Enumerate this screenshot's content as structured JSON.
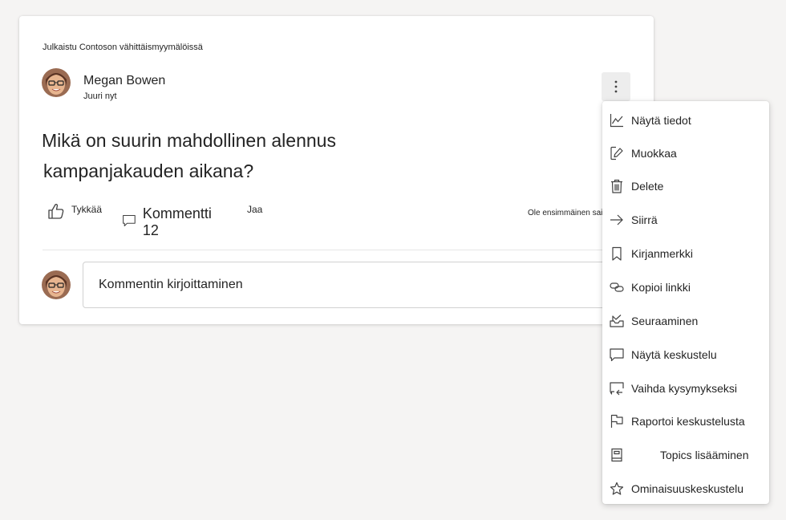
{
  "post": {
    "posted_in": "Julkaistu Contoson vähittäismyymälöissä",
    "author": "Megan Bowen",
    "time": "Juuri nyt",
    "question_line1": "Mikä on suurin mahdollinen alennus",
    "question_line2": "kampanjakauden aikana?",
    "actions": {
      "like_label": "Tykkää",
      "comment_label": "Kommentti 12",
      "share_label": "Jaa"
    },
    "first_to_like": "Ole ensimmäinen sairastunut"
  },
  "comment_box": {
    "placeholder": "Kommentin kirjoittaminen"
  },
  "menu": {
    "items": [
      {
        "label": "Näytä tiedot",
        "icon": "chart-icon"
      },
      {
        "label": "Muokkaa",
        "icon": "edit-icon"
      },
      {
        "label": "Delete",
        "icon": "trash-icon"
      },
      {
        "label": "Siirrä",
        "icon": "arrow-right-icon"
      },
      {
        "label": "Kirjanmerkki",
        "icon": "bookmark-icon"
      },
      {
        "label": "Kopioi linkki",
        "icon": "link-icon"
      },
      {
        "label": "Seuraaminen",
        "icon": "inbox-icon"
      },
      {
        "label": "Näytä keskustelu",
        "icon": "chat-icon"
      },
      {
        "label": "Vaihda kysymykseksi",
        "icon": "chat-switch-icon"
      },
      {
        "label": "Raportoi keskustelusta",
        "icon": "flag-icon"
      },
      {
        "label": "Topics lisääminen",
        "icon": "book-icon"
      },
      {
        "label": "Ominaisuuskeskustelu",
        "icon": "star-icon"
      }
    ]
  },
  "colors": {
    "page_background": "#f5f4f3",
    "card_background": "#ffffff",
    "text": "#242424",
    "more_button_background": "#ededed"
  }
}
